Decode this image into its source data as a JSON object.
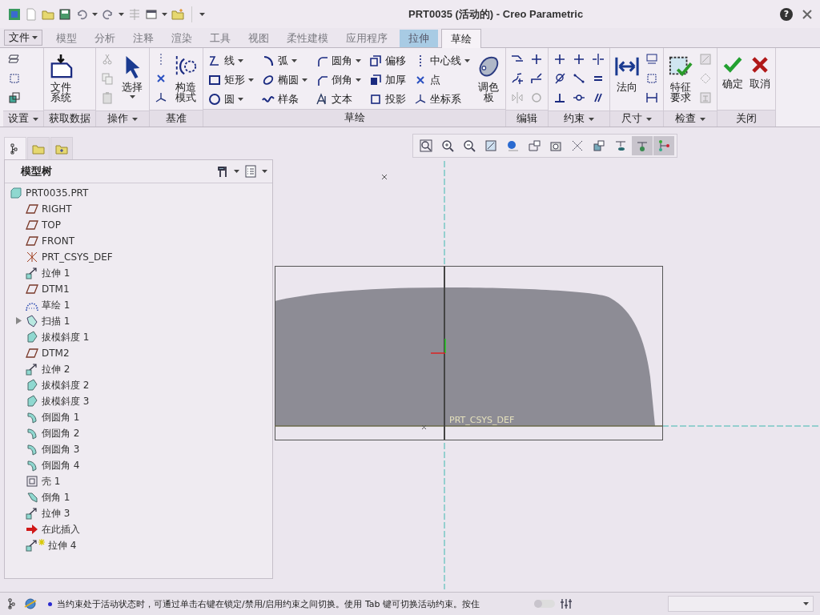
{
  "window": {
    "title": "PRT0035 (活动的) - Creo Parametric",
    "help": "?"
  },
  "file_menu": {
    "label": "文件",
    "dropdown": true
  },
  "tabs": [
    {
      "label": "模型",
      "kind": "main",
      "selected": false
    },
    {
      "label": "分析",
      "kind": "main",
      "selected": false
    },
    {
      "label": "注释",
      "kind": "main",
      "selected": false
    },
    {
      "label": "渲染",
      "kind": "main",
      "selected": false
    },
    {
      "label": "工具",
      "kind": "main",
      "selected": false
    },
    {
      "label": "视图",
      "kind": "main",
      "selected": false
    },
    {
      "label": "柔性建模",
      "kind": "main",
      "selected": false
    },
    {
      "label": "应用程序",
      "kind": "main",
      "selected": false
    },
    {
      "label": "拉伸",
      "kind": "context",
      "selected": false
    },
    {
      "label": "草绘",
      "kind": "context",
      "selected": true
    }
  ],
  "ribbon": [
    {
      "label": "设置",
      "dropdown": true
    },
    {
      "label": "获取数据",
      "dropdown": false,
      "tools": [
        {
          "label": "文件系统",
          "kind": "large",
          "dropdown": false
        }
      ]
    },
    {
      "label": "操作",
      "dropdown": true,
      "tools": [
        {
          "label": "选择",
          "kind": "large",
          "dropdown": true
        }
      ]
    },
    {
      "label": "基准",
      "dropdown": false,
      "tools": [
        {
          "label": "构造模式",
          "kind": "large",
          "dropdown": false
        }
      ]
    },
    {
      "label": "草绘",
      "dropdown": false,
      "tools": [
        {
          "label": "线",
          "kind": "small",
          "dropdown": true
        },
        {
          "label": "矩形",
          "kind": "small",
          "dropdown": true
        },
        {
          "label": "圆",
          "kind": "small",
          "dropdown": true
        },
        {
          "label": "弧",
          "kind": "small",
          "dropdown": true
        },
        {
          "label": "椭圆",
          "kind": "small",
          "dropdown": true
        },
        {
          "label": "样条",
          "kind": "small",
          "dropdown": false
        },
        {
          "label": "圆角",
          "kind": "small",
          "dropdown": true
        },
        {
          "label": "倒角",
          "kind": "small",
          "dropdown": true
        },
        {
          "label": "文本",
          "kind": "small",
          "dropdown": false
        },
        {
          "label": "偏移",
          "kind": "small",
          "dropdown": false
        },
        {
          "label": "加厚",
          "kind": "small",
          "dropdown": false
        },
        {
          "label": "投影",
          "kind": "small",
          "dropdown": false
        },
        {
          "label": "中心线",
          "kind": "small",
          "dropdown": true
        },
        {
          "label": "点",
          "kind": "small",
          "dropdown": false
        },
        {
          "label": "坐标系",
          "kind": "small",
          "dropdown": false
        },
        {
          "label": "调色板",
          "kind": "large",
          "dropdown": false
        }
      ]
    },
    {
      "label": "编辑",
      "dropdown": false
    },
    {
      "label": "约束",
      "dropdown": true
    },
    {
      "label": "尺寸",
      "dropdown": true,
      "tools": [
        {
          "label": "法向",
          "kind": "large",
          "dropdown": false
        }
      ]
    },
    {
      "label": "检查",
      "dropdown": true,
      "tools": [
        {
          "label": "特征要求",
          "kind": "large",
          "dropdown": false
        }
      ]
    },
    {
      "label": "关闭",
      "dropdown": false,
      "tools": [
        {
          "label": "确定",
          "kind": "large",
          "dropdown": false
        },
        {
          "label": "取消",
          "kind": "large",
          "dropdown": false
        }
      ]
    }
  ],
  "panel_tabs": [
    {
      "selected": true
    },
    {
      "selected": false
    },
    {
      "selected": false
    }
  ],
  "model_tree": {
    "title": "模型树",
    "root": {
      "label": "PRT0035.PRT",
      "kind": "part",
      "children": [
        {
          "label": "RIGHT",
          "kind": "plane",
          "collapsed": false,
          "new": false
        },
        {
          "label": "TOP",
          "kind": "plane",
          "collapsed": false,
          "new": false
        },
        {
          "label": "FRONT",
          "kind": "plane",
          "collapsed": false,
          "new": false
        },
        {
          "label": "PRT_CSYS_DEF",
          "kind": "csys",
          "collapsed": false,
          "new": false
        },
        {
          "label": "拉伸 1",
          "kind": "extrude",
          "collapsed": false,
          "new": false
        },
        {
          "label": "DTM1",
          "kind": "plane",
          "collapsed": false,
          "new": false
        },
        {
          "label": "草绘 1",
          "kind": "sketch",
          "collapsed": false,
          "new": false
        },
        {
          "label": "扫描 1",
          "kind": "sweep",
          "collapsed": true,
          "new": false
        },
        {
          "label": "拔模斜度 1",
          "kind": "draft",
          "collapsed": false,
          "new": false
        },
        {
          "label": "DTM2",
          "kind": "plane",
          "collapsed": false,
          "new": false
        },
        {
          "label": "拉伸 2",
          "kind": "extrude",
          "collapsed": false,
          "new": false
        },
        {
          "label": "拔模斜度 2",
          "kind": "draft",
          "collapsed": false,
          "new": false
        },
        {
          "label": "拔模斜度 3",
          "kind": "draft",
          "collapsed": false,
          "new": false
        },
        {
          "label": "倒圆角 1",
          "kind": "round",
          "collapsed": false,
          "new": false
        },
        {
          "label": "倒圆角 2",
          "kind": "round",
          "collapsed": false,
          "new": false
        },
        {
          "label": "倒圆角 3",
          "kind": "round",
          "collapsed": false,
          "new": false
        },
        {
          "label": "倒圆角 4",
          "kind": "round",
          "collapsed": false,
          "new": false
        },
        {
          "label": "壳 1",
          "kind": "shell",
          "collapsed": false,
          "new": false
        },
        {
          "label": "倒角 1",
          "kind": "chamfer",
          "collapsed": false,
          "new": false
        },
        {
          "label": "拉伸 3",
          "kind": "extrude",
          "collapsed": false,
          "new": false
        },
        {
          "label": "在此插入",
          "kind": "insert",
          "collapsed": false,
          "new": false
        },
        {
          "label": "拉伸 4",
          "kind": "extrude",
          "collapsed": false,
          "new": true
        }
      ]
    }
  },
  "view_toolbar": [
    {
      "on": false
    },
    {
      "on": false
    },
    {
      "on": false
    },
    {
      "on": false
    },
    {
      "on": false
    },
    {
      "on": false
    },
    {
      "on": false
    },
    {
      "on": false
    },
    {
      "on": false
    },
    {
      "on": false
    },
    {
      "on": true
    },
    {
      "on": true
    }
  ],
  "canvas": {
    "csys_label": "PRT_CSYS_DEF"
  },
  "status_bar": {
    "toggle_on": false,
    "message": "当约束处于活动状态时，可通过单击右键在锁定/禁用/启用约束之间切换。使用 Tab 键可切换活动约束。按住"
  }
}
